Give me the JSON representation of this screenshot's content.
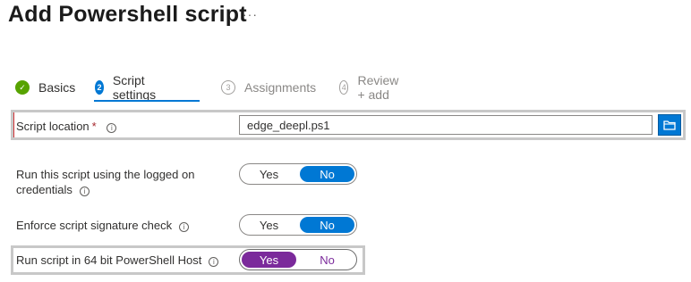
{
  "page": {
    "title": "Add Powershell script",
    "more_label": "···"
  },
  "wizard": {
    "steps": [
      {
        "number": "✓",
        "label": "Basics",
        "state": "completed"
      },
      {
        "number": "2",
        "label": "Script settings",
        "state": "current"
      },
      {
        "number": "3",
        "label": "Assignments",
        "state": "upcoming"
      },
      {
        "number": "4",
        "label": "Review + add",
        "state": "upcoming"
      }
    ]
  },
  "form": {
    "script_location": {
      "label": "Script location",
      "required_marker": "*",
      "value": "edge_deepl.ps1",
      "info_icon": "info-icon",
      "browse_icon": "folder-icon"
    },
    "run_as_logged_on": {
      "label_line1": "Run this script using the logged on",
      "label_line2": "credentials",
      "options": [
        "Yes",
        "No"
      ],
      "selected": "No"
    },
    "enforce_signature": {
      "label": "Enforce script signature check",
      "options": [
        "Yes",
        "No"
      ],
      "selected": "No"
    },
    "run_64bit": {
      "label": "Run script in 64 bit PowerShell Host",
      "options": [
        "Yes",
        "No"
      ],
      "selected": "Yes"
    }
  },
  "colors": {
    "accent": "#0078d4",
    "completed": "#57a300",
    "highlight_selected": "#7b2a9b",
    "required": "#a4262c",
    "highlight_box": "#c8c8c8"
  }
}
